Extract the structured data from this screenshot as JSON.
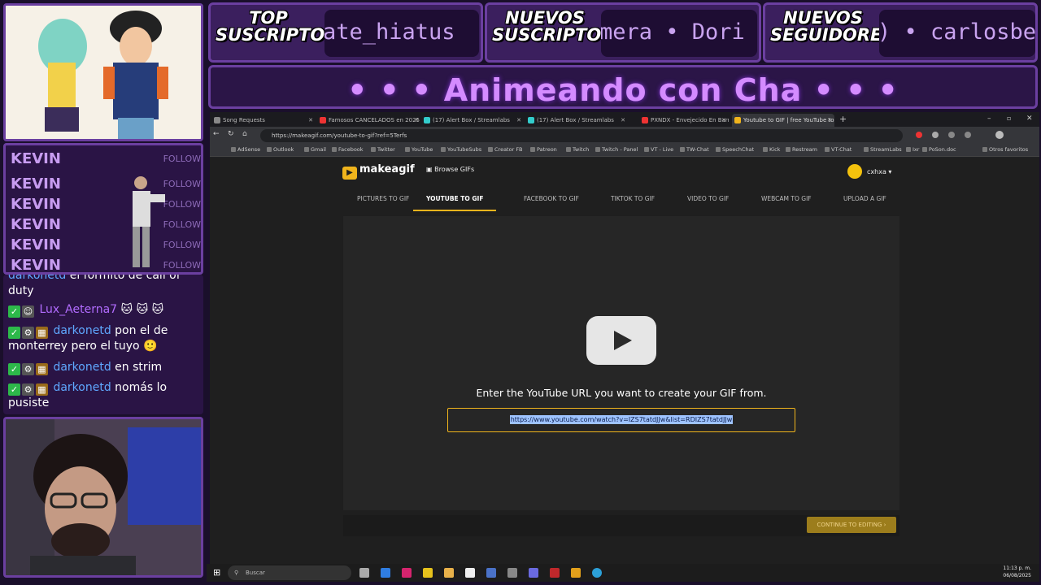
{
  "overlay": {
    "tickers": [
      {
        "label": "TOP SUSCRIPTORES",
        "text": "ate_hiatus"
      },
      {
        "label": "NUEVOS SUSCRIPTORES",
        "text": "mera • Dori"
      },
      {
        "label": "NUEVOS SEGUIDORES",
        "text": ") • carlosbe"
      }
    ],
    "banner_text": "• • • Animeando con Cha • • •",
    "follows": [
      {
        "name": "KEVIN",
        "tag": "FOLLOW"
      },
      {
        "name": "KEVIN",
        "tag": "FOLLOW"
      },
      {
        "name": "KEVIN",
        "tag": "FOLLOW"
      },
      {
        "name": "KEVIN",
        "tag": "FOLLOW"
      },
      {
        "name": "KEVIN",
        "tag": "FOLLOW"
      },
      {
        "name": "KEVIN",
        "tag": "FOLLOW"
      }
    ],
    "chat": [
      {
        "user": "darkonetd",
        "msg": "el formito de call of duty"
      },
      {
        "user": "Lux_Aeterna7",
        "msg": "🐱 🐱 🐱"
      },
      {
        "user": "darkonetd",
        "msg": "pon el de monterrey pero el tuyo 🙂"
      },
      {
        "user": "darkonetd",
        "msg": "en strim"
      },
      {
        "user": "darkonetd",
        "msg": "nomás lo pusiste"
      }
    ]
  },
  "browser": {
    "tabs": [
      {
        "title": "Song Requests"
      },
      {
        "title": "Famosos CANCELADOS en 2025"
      },
      {
        "title": "(17) Alert Box / Streamlabs"
      },
      {
        "title": "(17) Alert Box / Streamlabs"
      },
      {
        "title": "PXNDX - Envejecido En Barril"
      },
      {
        "title": "Youtube to GIF | free YouTube to"
      }
    ],
    "url": "https://makeagif.com/youtube-to-gif?ref=5Terfs",
    "bookmarks": [
      "AdSense",
      "Outlook",
      "Gmail",
      "Facebook",
      "Twitter",
      "YouTube",
      "YouTubeSubs",
      "Creator FB",
      "Patreon",
      "Twitch",
      "Twitch - Panel",
      "VT - Live",
      "TW-Chat",
      "SpeechChat",
      "Kick",
      "Restream",
      "VT-Chat",
      "StreamLabs",
      "Ixr",
      "PoSon.doc",
      "Otros favoritos"
    ]
  },
  "site": {
    "logo": "makeagif",
    "browse": "Browse GIFs",
    "user": "cxhxa",
    "nav": [
      "PICTURES TO GIF",
      "YOUTUBE TO GIF",
      "FACEBOOK TO GIF",
      "TIKTOK TO GIF",
      "VIDEO TO GIF",
      "WEBCAM TO GIF",
      "UPLOAD A GIF"
    ],
    "prompt": "Enter the YouTube URL you want to create your GIF from.",
    "input_value": "https://www.youtube.com/watch?v=IZS7tatdJJw&list=RDIZS7tatdJJw",
    "continue": "CONTINUE TO EDITING"
  },
  "taskbar": {
    "search_placeholder": "Buscar",
    "time": "11:13 p. m.",
    "date": "06/08/2025"
  }
}
